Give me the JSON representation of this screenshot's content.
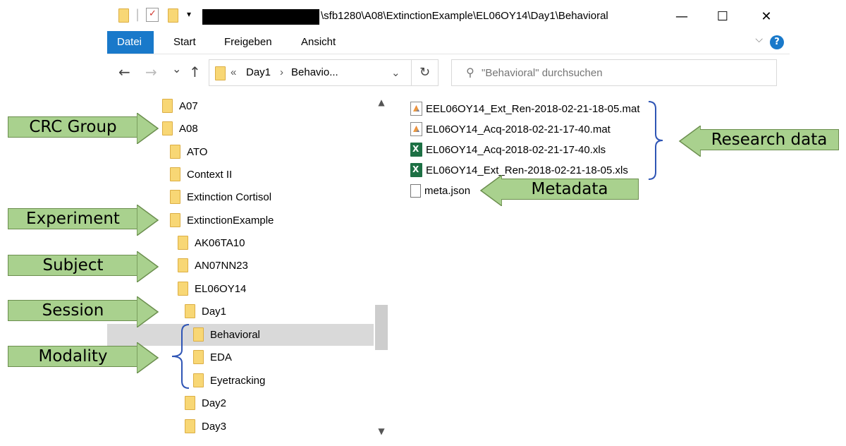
{
  "window": {
    "path_suffix": "\\sfb1280\\A08\\ExtinctionExample\\EL06OY14\\Day1\\Behavioral",
    "controls": {
      "minimize": "—",
      "maximize": "☐",
      "close": "✕"
    }
  },
  "ribbon": {
    "tabs": [
      "Datei",
      "Start",
      "Freigeben",
      "Ansicht"
    ],
    "help": "?",
    "collapse": "⌵"
  },
  "nav": {
    "back": "←",
    "forward": "→",
    "recent": "⌄",
    "up": "↑",
    "overflow": "«",
    "crumbs": [
      "Day1",
      "Behavio..."
    ],
    "separator": "›",
    "dropdown": "⌄",
    "refresh": "↻",
    "search_placeholder": "\"Behavioral\" durchsuchen"
  },
  "tree": {
    "items": [
      {
        "label": "A07"
      },
      {
        "label": "A08"
      },
      {
        "label": "ATO"
      },
      {
        "label": "Context II"
      },
      {
        "label": "Extinction Cortisol"
      },
      {
        "label": "ExtinctionExample"
      },
      {
        "label": "AK06TA10"
      },
      {
        "label": "AN07NN23"
      },
      {
        "label": "EL06OY14"
      },
      {
        "label": "Day1"
      },
      {
        "label": "Behavioral"
      },
      {
        "label": "EDA"
      },
      {
        "label": "Eyetracking"
      },
      {
        "label": "Day2"
      },
      {
        "label": "Day3"
      }
    ],
    "selected": "Behavioral"
  },
  "files": [
    {
      "name": "EEL06OY14_Ext_Ren-2018-02-21-18-05.mat",
      "icon": "matlab-file-icon"
    },
    {
      "name": "EL06OY14_Acq-2018-02-21-17-40.mat",
      "icon": "matlab-file-icon"
    },
    {
      "name": "EL06OY14_Acq-2018-02-21-17-40.xls",
      "icon": "excel-file-icon"
    },
    {
      "name": "EL06OY14_Ext_Ren-2018-02-21-18-05.xls",
      "icon": "excel-file-icon"
    },
    {
      "name": "meta.json",
      "icon": "text-file-icon"
    }
  ],
  "annotations": {
    "crc_group": "CRC Group",
    "experiment": "Experiment",
    "subject": "Subject",
    "session": "Session",
    "modality": "Modality",
    "research_data": "Research data",
    "metadata": "Metadata"
  },
  "colors": {
    "accent": "#1979ca",
    "folder": "#f8d775",
    "arrow_fill": "#a9d18e",
    "arrow_border": "#6b8e4e",
    "brace": "#2f55b5",
    "selection": "#d9d9d9"
  }
}
